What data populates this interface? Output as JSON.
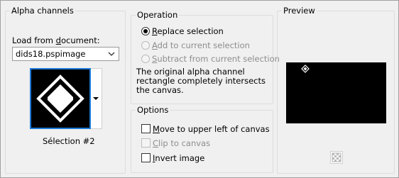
{
  "alpha": {
    "title": "Alpha channels",
    "load_label_pre": "Load from ",
    "load_label_u": "d",
    "load_label_post": "ocument:",
    "document": "dids18.pspimage",
    "selection_caption": "Sélection #2"
  },
  "operation": {
    "title": "Operation",
    "options": [
      {
        "u": "R",
        "rest": "eplace selection",
        "checked": true,
        "enabled": true
      },
      {
        "u": "A",
        "rest": "dd to current selection",
        "checked": false,
        "enabled": false
      },
      {
        "u": "S",
        "rest": "ubtract from current selection",
        "checked": false,
        "enabled": false
      }
    ],
    "description": "The original alpha channel rectangle completely intersects the canvas."
  },
  "options": {
    "title": "Options",
    "items": [
      {
        "u": "M",
        "rest": "ove to upper left of canvas",
        "checked": false,
        "enabled": true
      },
      {
        "u": "C",
        "rest": "lip to canvas",
        "checked": false,
        "enabled": false
      },
      {
        "u": "I",
        "rest": "nvert image",
        "checked": false,
        "enabled": true
      }
    ]
  },
  "preview": {
    "title": "Preview"
  }
}
